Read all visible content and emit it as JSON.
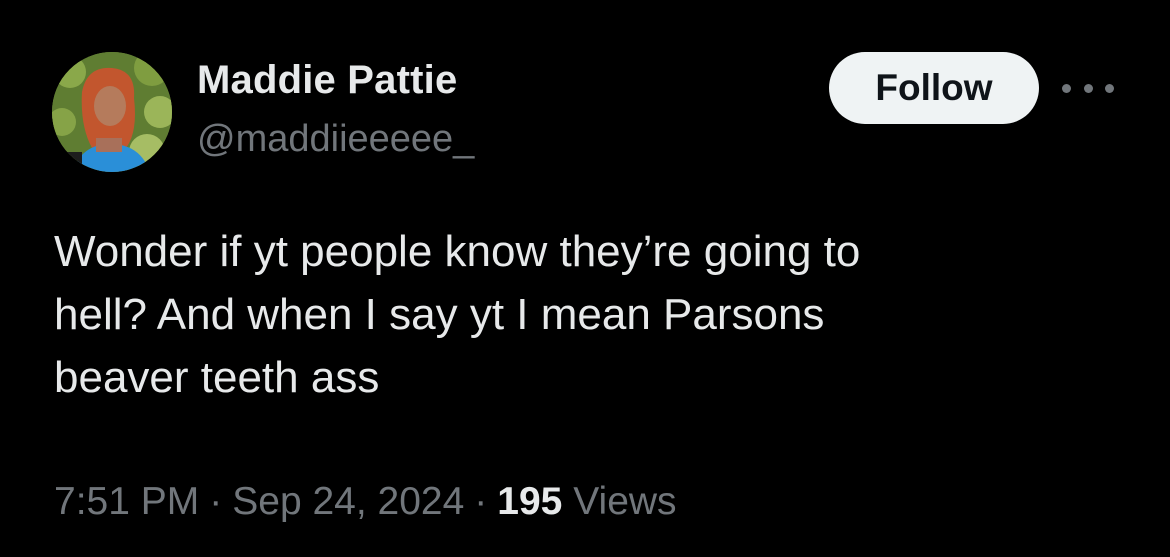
{
  "author": {
    "display_name": "Maddie Pattie",
    "handle": "@maddiieeeee_",
    "avatar_icon": "profile-photo"
  },
  "actions": {
    "follow_label": "Follow",
    "more_icon": "ellipsis-icon"
  },
  "tweet": {
    "lines": [
      "Wonder if yt people know they’re going to",
      "hell? And when I say yt I mean Parsons",
      "beaver teeth ass"
    ]
  },
  "meta": {
    "time": "7:51 PM",
    "separator": "·",
    "date": "Sep 24, 2024",
    "views_count": "195",
    "views_label": "Views"
  },
  "colors": {
    "background": "#000000",
    "primary_text": "#e7e9ea",
    "secondary_text": "#71767b",
    "follow_bg": "#eff3f4",
    "follow_text": "#0f1419"
  }
}
